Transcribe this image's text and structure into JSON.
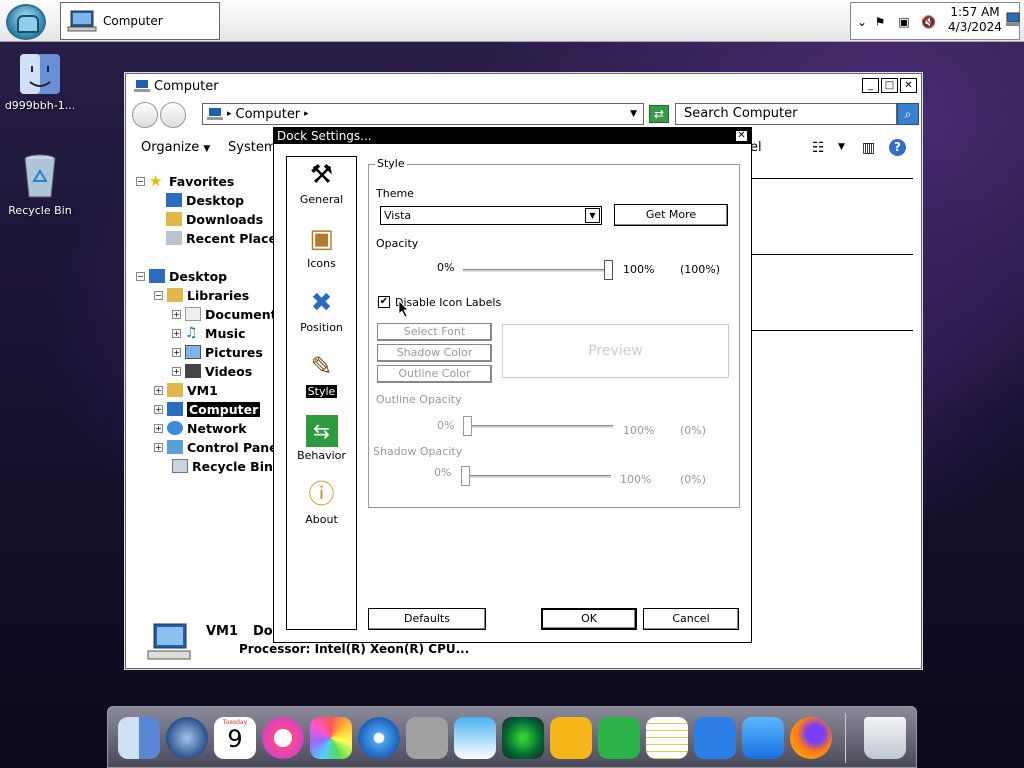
{
  "taskbar": {
    "task_button_label": "Computer",
    "clock_time": "1:57 AM",
    "clock_date": "4/3/2024"
  },
  "desktop": {
    "icons": [
      {
        "label": "d999bbh-1..."
      },
      {
        "label": "Recycle Bin"
      }
    ]
  },
  "explorer": {
    "title": "Computer",
    "address": "Computer",
    "search_placeholder": "Search Computer",
    "toolbar": {
      "organize": "Organize",
      "system": "System",
      "panel_label": "el"
    },
    "tree": {
      "favorites": "Favorites",
      "desktop_fav": "Desktop",
      "downloads": "Downloads",
      "recent": "Recent Places",
      "desktop": "Desktop",
      "libraries": "Libraries",
      "documents": "Documents",
      "music": "Music",
      "pictures": "Pictures",
      "videos": "Videos",
      "vm1": "VM1",
      "computer": "Computer",
      "network": "Network",
      "control_panel": "Control Panel",
      "recycle_bin": "Recycle Bin"
    },
    "status": {
      "name": "VM1",
      "domain_label": "Dor",
      "processor": "Processor: Intel(R) Xeon(R) CPU..."
    }
  },
  "dialog": {
    "title": "Dock Settings...",
    "nav": [
      {
        "label": "General"
      },
      {
        "label": "Icons"
      },
      {
        "label": "Position"
      },
      {
        "label": "Style"
      },
      {
        "label": "Behavior"
      },
      {
        "label": "About"
      }
    ],
    "group_label": "Style",
    "theme_label": "Theme",
    "theme_value": "Vista",
    "get_more": "Get More",
    "opacity_label": "Opacity",
    "opacity_min": "0%",
    "opacity_max": "100%",
    "opacity_value": "(100%)",
    "opacity_level": 1.0,
    "disable_labels": "Disable Icon Labels",
    "disable_labels_checked": true,
    "select_font": "Select Font",
    "shadow_color": "Shadow Color",
    "outline_color": "Outline Color",
    "preview": "Preview",
    "outline_opacity_label": "Outline Opacity",
    "outline_min": "0%",
    "outline_max": "100%",
    "outline_value": "(0%)",
    "shadow_opacity_label": "Shadow Opacity",
    "shadow_min": "0%",
    "shadow_max": "100%",
    "shadow_value": "(0%)",
    "defaults": "Defaults",
    "ok": "OK",
    "cancel": "Cancel"
  },
  "dock": {
    "calendar_day": "Tuesday",
    "calendar_date": "9"
  }
}
